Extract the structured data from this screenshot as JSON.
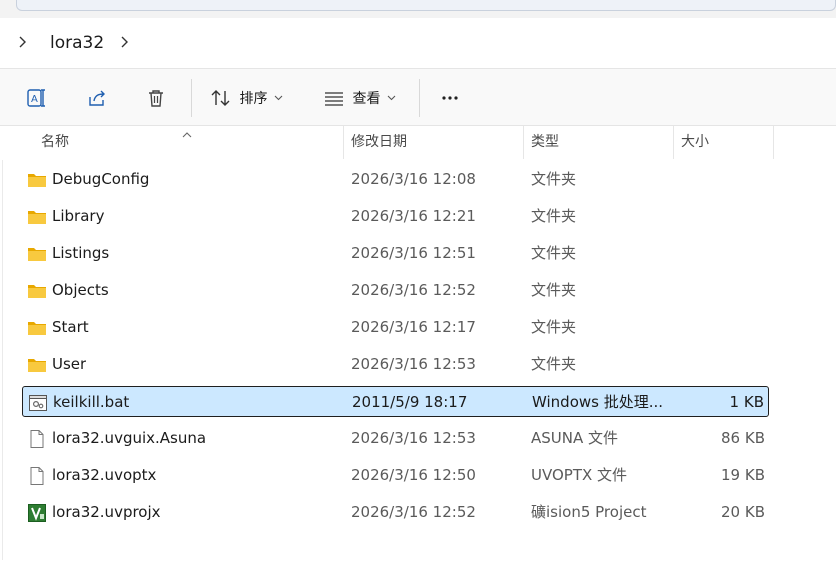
{
  "address": {
    "path": [
      "lora32"
    ]
  },
  "toolbar": {
    "sort_label": "排序",
    "view_label": "查看",
    "more_label": "..."
  },
  "columns": {
    "name": "名称",
    "date": "修改日期",
    "type": "类型",
    "size": "大小"
  },
  "files": [
    {
      "name": "DebugConfig",
      "date": "2026/3/16 12:08",
      "type": "文件夹",
      "size": "",
      "icon": "folder-icon"
    },
    {
      "name": "Library",
      "date": "2026/3/16 12:21",
      "type": "文件夹",
      "size": "",
      "icon": "folder-icon"
    },
    {
      "name": "Listings",
      "date": "2026/3/16 12:51",
      "type": "文件夹",
      "size": "",
      "icon": "folder-icon"
    },
    {
      "name": "Objects",
      "date": "2026/3/16 12:52",
      "type": "文件夹",
      "size": "",
      "icon": "folder-icon"
    },
    {
      "name": "Start",
      "date": "2026/3/16 12:17",
      "type": "文件夹",
      "size": "",
      "icon": "folder-icon"
    },
    {
      "name": "User",
      "date": "2026/3/16 12:53",
      "type": "文件夹",
      "size": "",
      "icon": "folder-icon"
    },
    {
      "name": "keilkill.bat",
      "date": "2011/5/9 18:17",
      "type": "Windows 批处理...",
      "size": "1 KB",
      "icon": "batch-file-icon",
      "selected": true
    },
    {
      "name": "lora32.uvguix.Asuna",
      "date": "2026/3/16 12:53",
      "type": "ASUNA 文件",
      "size": "86 KB",
      "icon": "file-icon"
    },
    {
      "name": "lora32.uvoptx",
      "date": "2026/3/16 12:50",
      "type": "UVOPTX 文件",
      "size": "19 KB",
      "icon": "file-icon"
    },
    {
      "name": "lora32.uvprojx",
      "date": "2026/3/16 12:52",
      "type": "礦ision5 Project",
      "size": "20 KB",
      "icon": "keil-project-icon"
    }
  ],
  "colors": {
    "selection_bg": "#cce8ff",
    "folder": "#f5c542",
    "accent": "#005fb8"
  }
}
